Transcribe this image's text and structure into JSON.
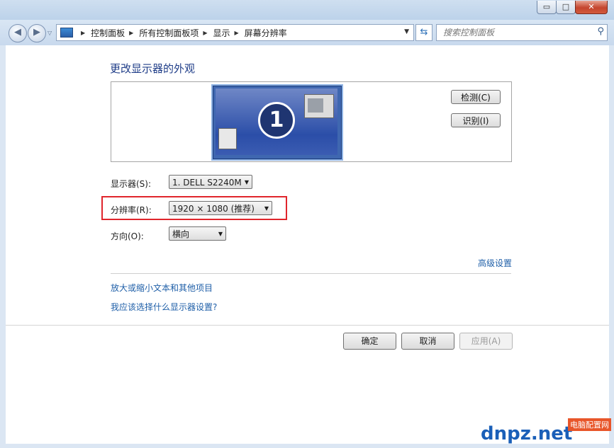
{
  "breadcrumb": [
    "控制面板",
    "所有控制面板项",
    "显示",
    "屏幕分辨率"
  ],
  "search": {
    "placeholder": "搜索控制面板"
  },
  "caption_buttons": {
    "minimize": "▭",
    "maximize": "□",
    "close": "✕"
  },
  "heading": "更改显示器的外观",
  "preview": {
    "monitor_number": "1",
    "detect_label": "检测(C)",
    "identify_label": "识别(I)"
  },
  "display": {
    "label": "显示器(S):",
    "value": "1. DELL S2240M"
  },
  "resolution": {
    "label": "分辨率(R):",
    "value": "1920 × 1080 (推荐)"
  },
  "orientation": {
    "label": "方向(O):",
    "value": "横向"
  },
  "links": {
    "advanced": "高级设置",
    "text_size": "放大或缩小文本和其他项目",
    "which_settings": "我应该选择什么显示器设置?"
  },
  "footer": {
    "ok": "确定",
    "cancel": "取消",
    "apply": "应用(A)"
  },
  "watermark": {
    "text": "dnpz.net",
    "tag": "电脑配置网"
  },
  "colors": {
    "highlight_border": "#e0252c",
    "link": "#1f5fa8",
    "heading": "#1f3d88"
  }
}
